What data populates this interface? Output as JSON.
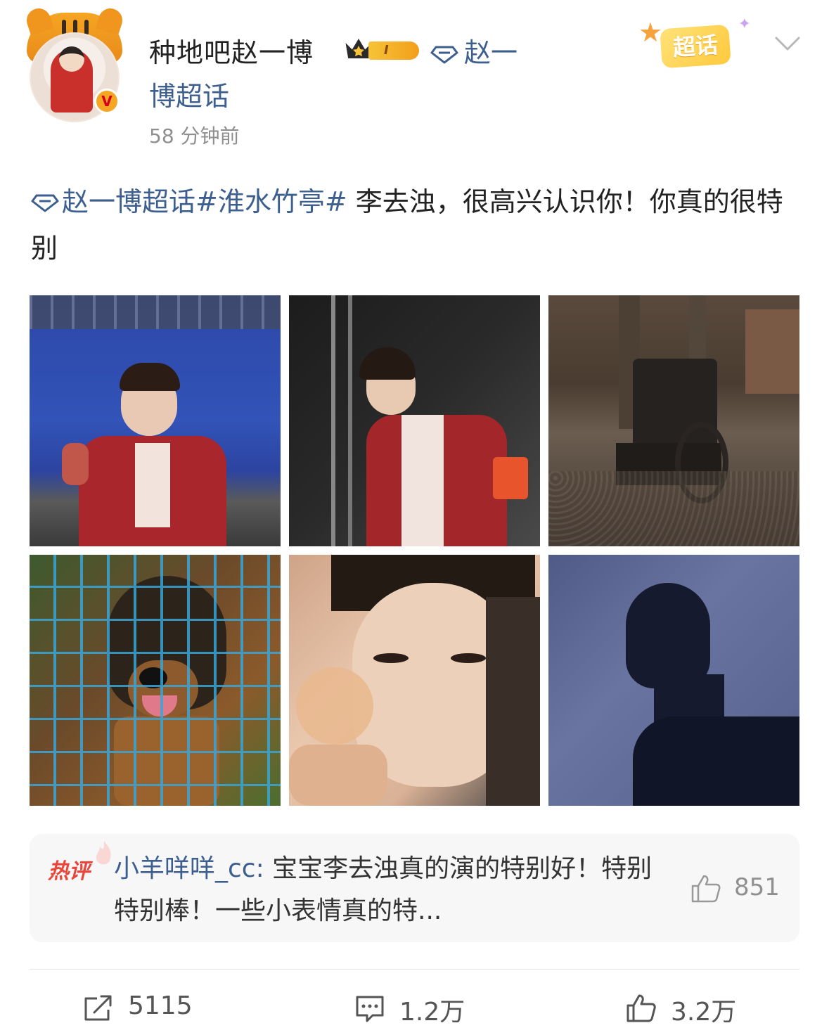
{
  "post": {
    "author": "种地吧赵一博",
    "level": "I",
    "super_topic_line1": "赵一",
    "super_topic_line2": "博超话",
    "time": "58 分钟前",
    "verified_badge": "V",
    "text_topic": "赵一博超话",
    "text_hashtag": "#淮水竹亭#",
    "text_body": " 李去浊，很高兴认识你！你真的很特别",
    "chaohua_button": "超话"
  },
  "images": [
    {
      "icon": "photo-blue-screen-thumbs-up"
    },
    {
      "icon": "photo-seated-costume"
    },
    {
      "icon": "photo-wheelchair-set"
    },
    {
      "icon": "photo-puppy-cage"
    },
    {
      "icon": "photo-makeup-closeup"
    },
    {
      "icon": "photo-shadow-silhouette"
    }
  ],
  "hot_comment": {
    "label": "热评",
    "user": "小羊咩咩_cc:",
    "text": " 宝宝李去浊真的演的特别好！特别特别棒！一些小表情真的特...",
    "likes": "851"
  },
  "actions": {
    "shares": "5115",
    "comments": "1.2万",
    "likes": "3.2万"
  },
  "colors": {
    "link": "#3d5f8f",
    "hot_label": "#e8463a",
    "muted": "#8f8f8f",
    "badge_gold": "#f5a623"
  }
}
